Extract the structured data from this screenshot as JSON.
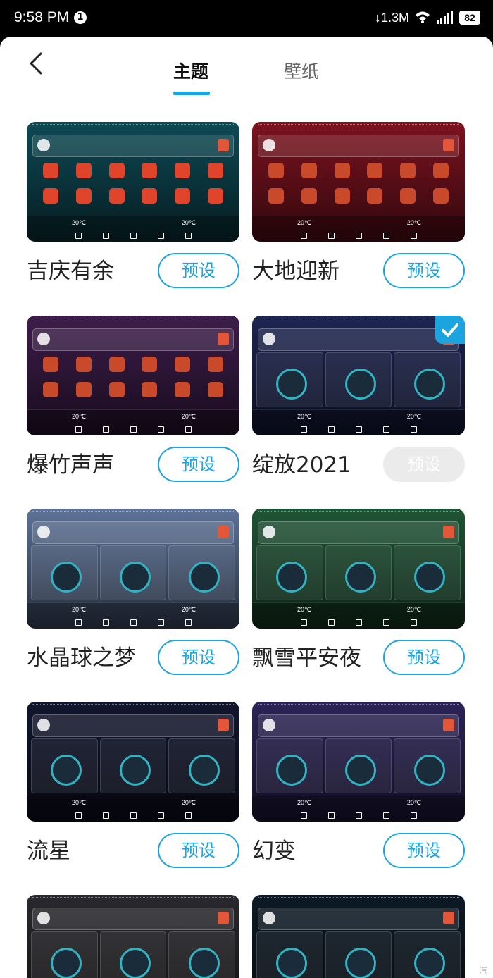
{
  "status_bar": {
    "time": "9:58 PM",
    "notification_count": "1",
    "net_speed": "↓1.3M",
    "battery": "82"
  },
  "tabs": {
    "themes": "主题",
    "wallpapers": "壁纸"
  },
  "themes": [
    {
      "name": "吉庆有余",
      "button": "预设",
      "preset_enabled": true,
      "selected": false,
      "bg": "#0e4a55"
    },
    {
      "name": "大地迎新",
      "button": "预设",
      "preset_enabled": true,
      "selected": false,
      "bg": "#7e1320"
    },
    {
      "name": "爆竹声声",
      "button": "预设",
      "preset_enabled": true,
      "selected": false,
      "bg": "#3d1d4a"
    },
    {
      "name": "绽放2021",
      "button": "预设",
      "preset_enabled": false,
      "selected": true,
      "bg": "#1d2552"
    },
    {
      "name": "水晶球之梦",
      "button": "预设",
      "preset_enabled": true,
      "selected": false,
      "bg": "#5d7398"
    },
    {
      "name": "飘雪平安夜",
      "button": "预设",
      "preset_enabled": true,
      "selected": false,
      "bg": "#1f5535"
    },
    {
      "name": "流星",
      "button": "预设",
      "preset_enabled": true,
      "selected": false,
      "bg": "#12162e"
    },
    {
      "name": "幻变",
      "button": "预设",
      "preset_enabled": true,
      "selected": false,
      "bg": "#2c2458"
    },
    {
      "name": "",
      "button": "",
      "preset_enabled": true,
      "selected": false,
      "bg": "#2a2a2e"
    },
    {
      "name": "",
      "button": "",
      "preset_enabled": true,
      "selected": false,
      "bg": "#0d1a26"
    }
  ],
  "thumb_temp": "20℃",
  "watermark": "汽"
}
